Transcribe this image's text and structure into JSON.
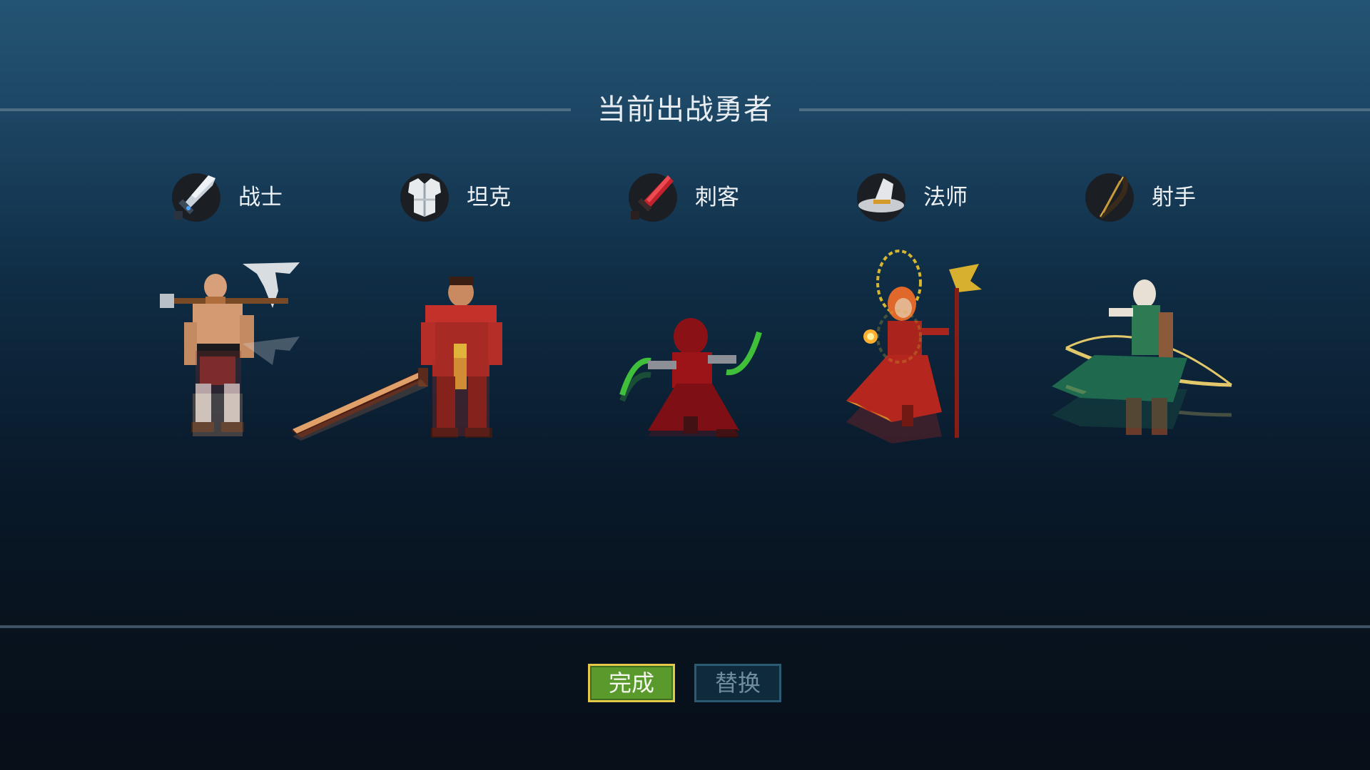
{
  "header": {
    "title": "当前出战勇者"
  },
  "classes": [
    {
      "key": "warrior",
      "label": "战士",
      "icon": "sword-icon"
    },
    {
      "key": "tank",
      "label": "坦克",
      "icon": "chestplate-icon"
    },
    {
      "key": "assassin",
      "label": "刺客",
      "icon": "dagger-icon"
    },
    {
      "key": "mage",
      "label": "法师",
      "icon": "wizard-hat-icon"
    },
    {
      "key": "archer",
      "label": "射手",
      "icon": "bow-icon"
    }
  ],
  "actions": {
    "done_label": "完成",
    "replace_label": "替换"
  },
  "colors": {
    "done_button": "#5a9a2c",
    "done_border": "#e3c84a",
    "replace_button": "#0f2a3a",
    "replace_border": "#2b5b72",
    "divider": "#3d5364"
  }
}
